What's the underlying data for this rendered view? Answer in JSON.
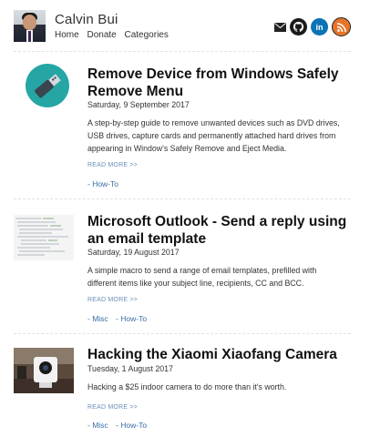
{
  "header": {
    "name": "Calvin Bui",
    "nav": [
      "Home",
      "Donate",
      "Categories"
    ],
    "social_icons": [
      "mail-icon",
      "github-icon",
      "linkedin-icon",
      "rss-icon"
    ]
  },
  "posts": [
    {
      "title": "Remove Device from Windows Safely Remove Menu",
      "date": "Saturday, 9 September 2017",
      "excerpt": "A step-by-step guide to remove unwanted devices such as DVD drives, USB drives, capture cards and permanently attached hard drives from appearing in Window's Safely Remove and Eject Media.",
      "read_more": "READ MORE >>",
      "tags": [
        "- How-To"
      ]
    },
    {
      "title": "Microsoft Outlook - Send a reply using an email template",
      "date": "Saturday, 19 August 2017",
      "excerpt": "A simple macro to send a range of email templates, prefilled with different items like your subject line, recipients, CC and BCC.",
      "read_more": "READ MORE >>",
      "tags": [
        "- Misc",
        "- How-To"
      ]
    },
    {
      "title": "Hacking the Xiaomi Xiaofang Camera",
      "date": "Tuesday, 1 August 2017",
      "excerpt": "Hacking a $25 indoor camera to do more than it's worth.",
      "read_more": "READ MORE >>",
      "tags": [
        "- Misc",
        "- How-To"
      ]
    }
  ]
}
